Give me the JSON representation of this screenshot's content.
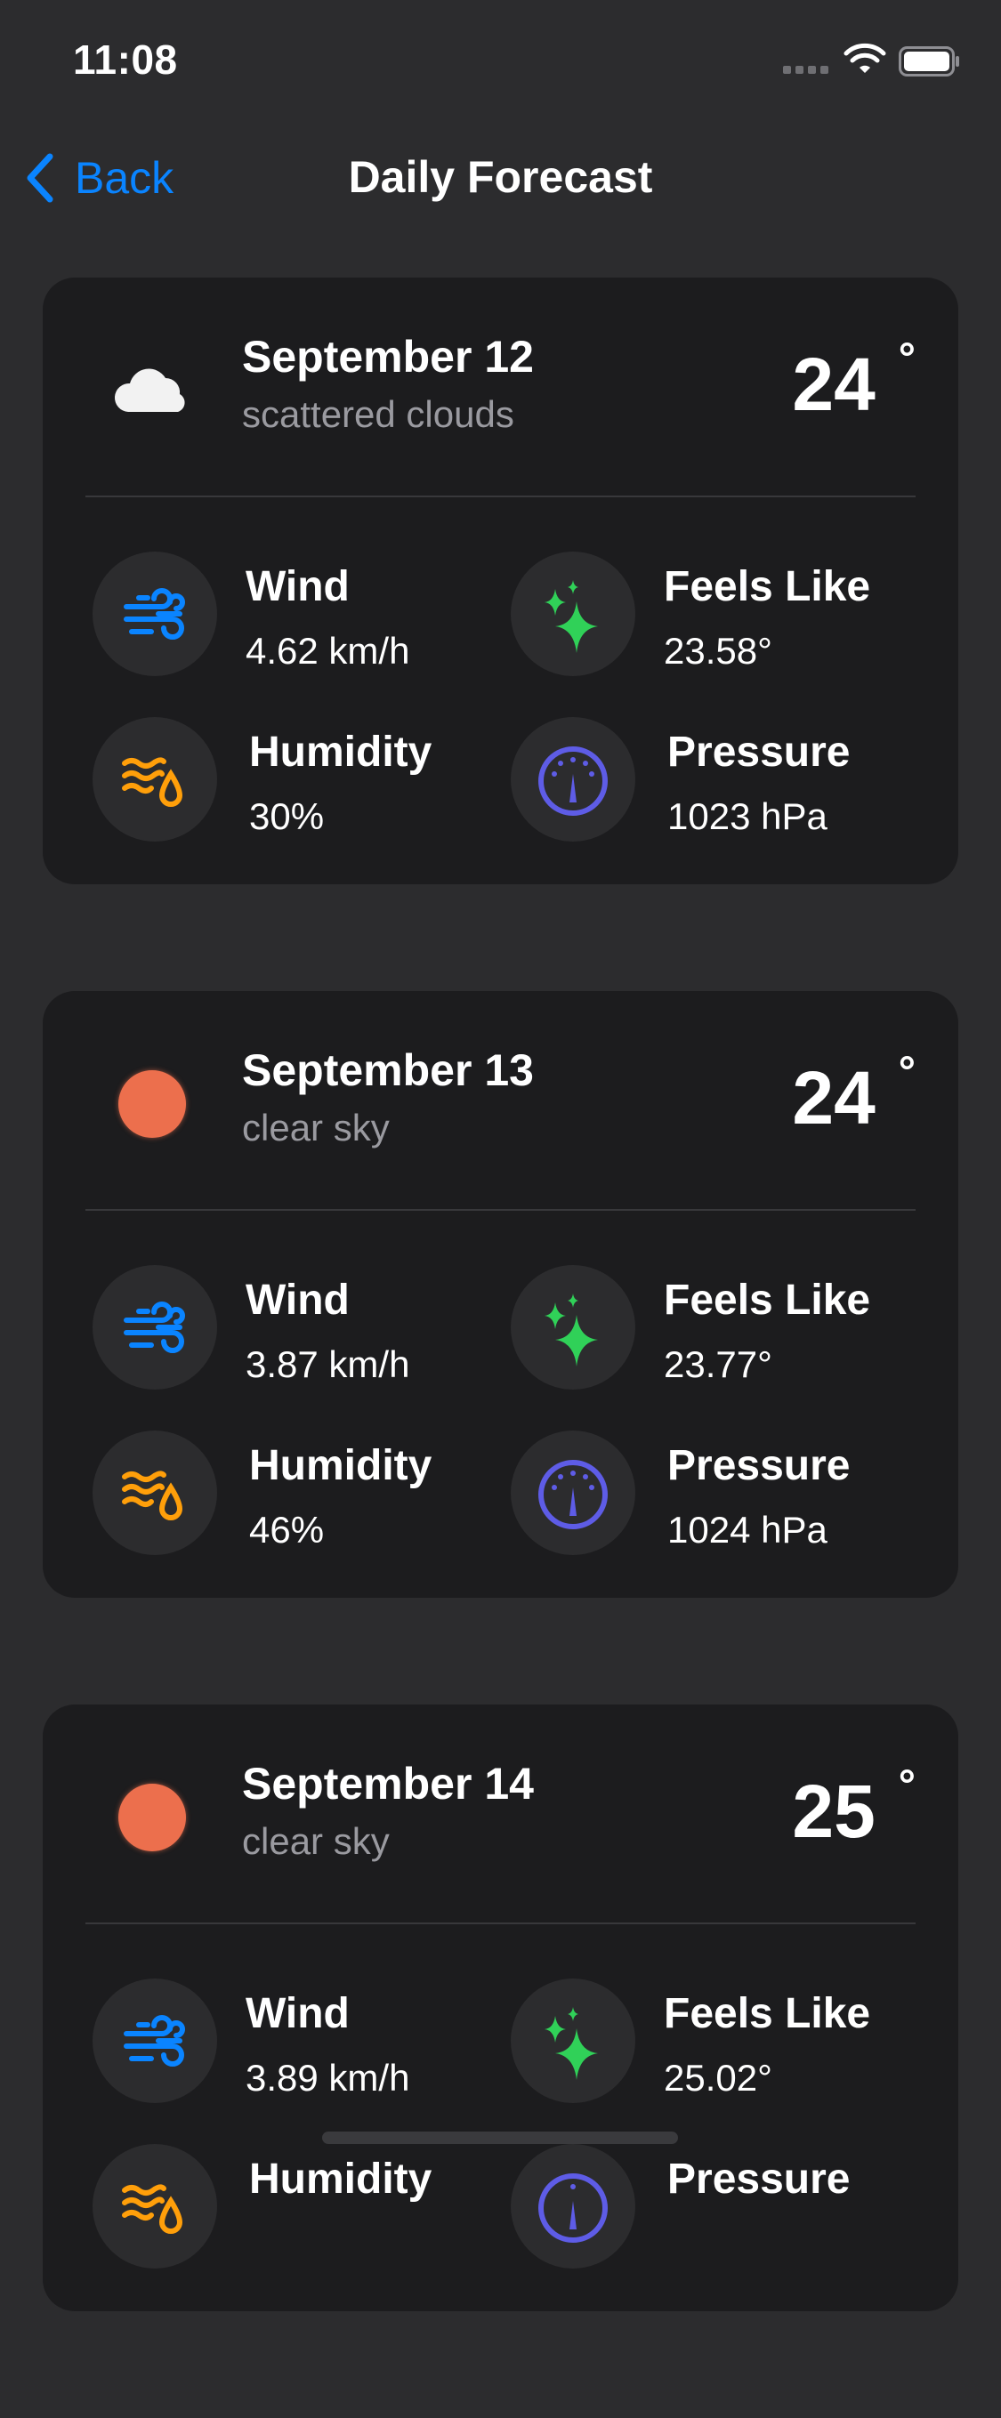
{
  "status_bar": {
    "time": "11:08"
  },
  "nav": {
    "back_label": "Back",
    "title": "Daily Forecast"
  },
  "colors": {
    "accent": "#0a84ff",
    "wind": "#0a84ff",
    "feels": "#30d158",
    "humidity": "#ff9f0a",
    "pressure": "#5e5ce6",
    "sun": "#ec6f4d"
  },
  "stat_labels": {
    "wind": "Wind",
    "feels": "Feels Like",
    "humidity": "Humidity",
    "pressure": "Pressure"
  },
  "days": [
    {
      "date": "September 12",
      "description": "scattered clouds",
      "icon": "cloud-icon",
      "temp": "24",
      "degree": "°",
      "wind": "4.62 km/h",
      "feels": "23.58°",
      "humidity": "30%",
      "pressure": "1023 hPa"
    },
    {
      "date": "September 13",
      "description": "clear sky",
      "icon": "sun-icon",
      "temp": "24",
      "degree": "°",
      "wind": "3.87 km/h",
      "feels": "23.77°",
      "humidity": "46%",
      "pressure": "1024 hPa"
    },
    {
      "date": "September 14",
      "description": "clear sky",
      "icon": "sun-icon",
      "temp": "25",
      "degree": "°",
      "wind": "3.89 km/h",
      "feels": "25.02°",
      "humidity": "",
      "pressure": ""
    }
  ]
}
